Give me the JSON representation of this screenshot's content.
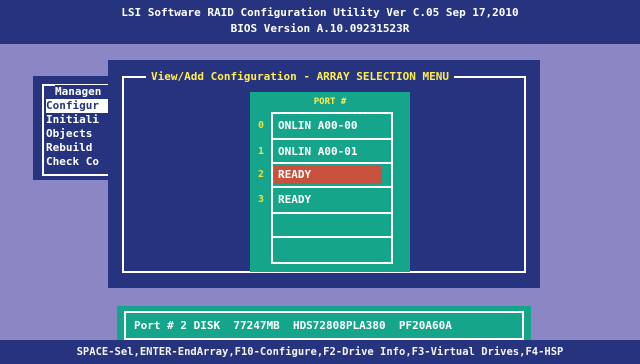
{
  "header": {
    "line1": "LSI Software RAID Configuration Utility Ver C.05 Sep 17,2010",
    "line2": "BIOS Version  A.10.09231523R"
  },
  "management_menu": {
    "title": "Managen",
    "items": [
      {
        "label": "Configur",
        "selected": true
      },
      {
        "label": "Initiali",
        "selected": false
      },
      {
        "label": "Objects",
        "selected": false
      },
      {
        "label": "Rebuild",
        "selected": false
      },
      {
        "label": "Check Co",
        "selected": false
      }
    ]
  },
  "array_menu": {
    "title": "View/Add Configuration - ARRAY SELECTION MENU",
    "ports_header": "PORT #",
    "ports": [
      {
        "num": "0",
        "status": "ONLIN A00-00"
      },
      {
        "num": "1",
        "status": "ONLIN A00-01"
      },
      {
        "num": "2",
        "status": "READY",
        "selected": true
      },
      {
        "num": "3",
        "status": "READY"
      },
      {
        "num": "",
        "status": ""
      },
      {
        "num": "",
        "status": ""
      }
    ]
  },
  "drive_info": "Port # 2 DISK  77247MB  HDS72808PLA380  PF20A60A",
  "status_bar": "SPACE-Sel,ENTER-EndArray,F10-Configure,F2-Drive Info,F3-Virtual Drives,F4-HSP",
  "colors": {
    "background": "#8a87c4",
    "panel_blue": "#26337f",
    "panel_green": "#14a58a",
    "highlight_red": "#c9503d",
    "title_yellow": "#ffec50"
  }
}
